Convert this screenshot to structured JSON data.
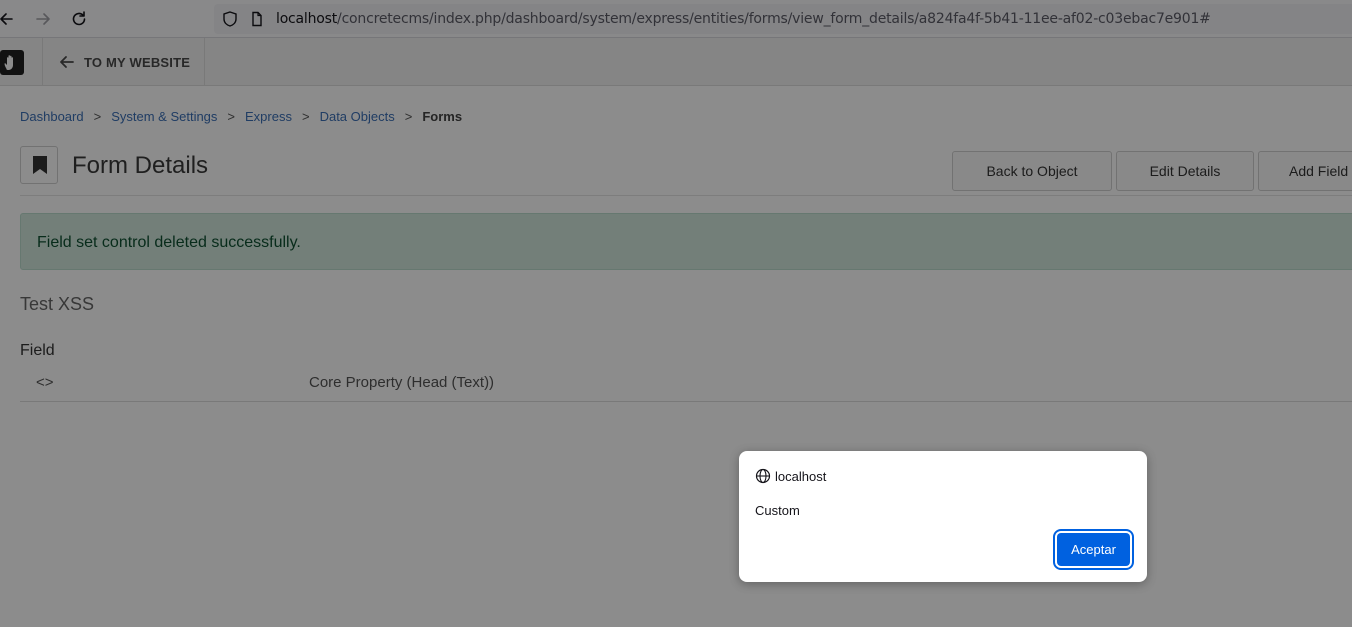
{
  "browser": {
    "url_host": "localhost",
    "url_path": "/concretecms/index.php/dashboard/system/express/entities/forms/view_form_details/a824fa4f-5b41-11ee-af02-c03ebac7e901#"
  },
  "toolbar": {
    "back_label": "TO MY WEBSITE"
  },
  "breadcrumb": {
    "items": [
      "Dashboard",
      "System & Settings",
      "Express",
      "Data Objects"
    ],
    "current": "Forms",
    "separator": ">"
  },
  "header": {
    "title": "Form Details",
    "buttons": [
      "Back to Object",
      "Edit Details",
      "Add Field"
    ]
  },
  "alert": {
    "message": "Field set control deleted successfully."
  },
  "fieldset": {
    "title": "Test XSS",
    "column_header": "Field",
    "rows": [
      {
        "name": "<>",
        "type": "Core Property (Head (Text))"
      }
    ]
  },
  "dialog": {
    "origin": "localhost",
    "message": "Custom",
    "ok_label": "Aceptar"
  },
  "colors": {
    "accent": "#0061e0",
    "link": "#3b6fb6",
    "alert_bg": "#d1e7dd",
    "alert_text": "#0f5132"
  }
}
